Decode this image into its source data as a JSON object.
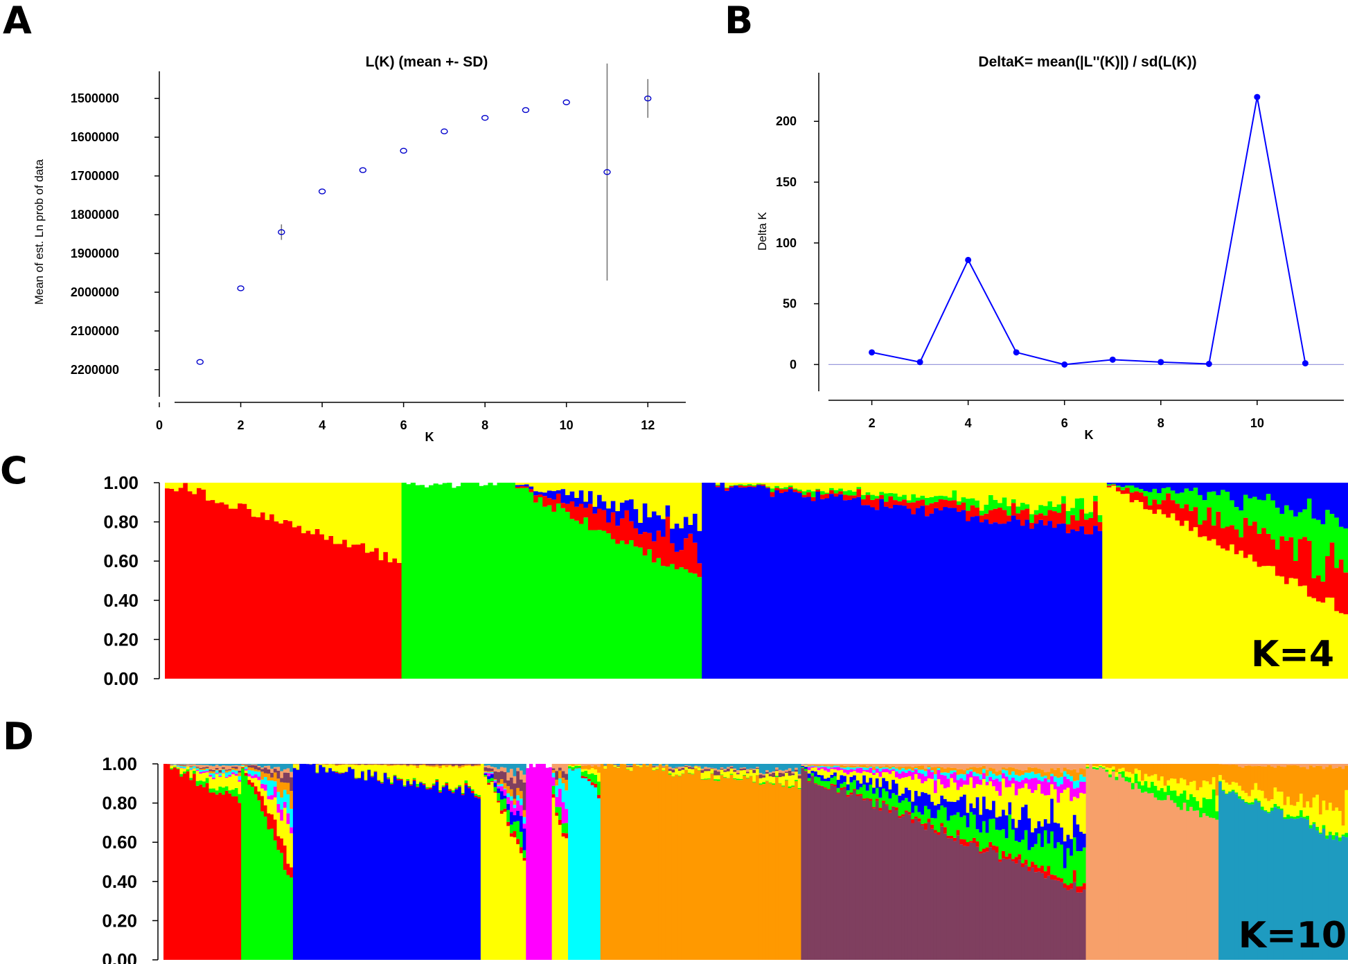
{
  "panel_labels": [
    "A",
    "B",
    "C",
    "D"
  ],
  "chart_data": [
    {
      "panel": "A",
      "type": "scatter",
      "title": "L(K) (mean +- SD)",
      "xlabel": "K",
      "ylabel": "Mean of est. Ln prob of data",
      "xlim": [
        0,
        13
      ],
      "ylim": [
        1430000,
        2270000
      ],
      "y_reversed": true,
      "x_ticks": [
        0,
        2,
        4,
        6,
        8,
        10,
        12
      ],
      "y_ticks": [
        1500000,
        1600000,
        1700000,
        1800000,
        1900000,
        2000000,
        2100000,
        2200000
      ],
      "x": [
        1,
        2,
        3,
        4,
        5,
        6,
        7,
        8,
        9,
        10,
        11,
        12
      ],
      "y": [
        2180000,
        1990000,
        1845000,
        1740000,
        1685000,
        1635000,
        1585000,
        1550000,
        1530000,
        1510000,
        1690000,
        1500000
      ],
      "sd": [
        0,
        0,
        20000,
        0,
        0,
        0,
        0,
        0,
        0,
        0,
        280000,
        50000
      ],
      "marker": "open-circle",
      "color": "#0000cc",
      "errorbar_color": "#777777"
    },
    {
      "panel": "B",
      "type": "line",
      "title": "DeltaK= mean(|L''(K)|) / sd(L(K))",
      "xlabel": "K",
      "ylabel": "Delta K",
      "xlim": [
        1.1,
        11.8
      ],
      "ylim": [
        -22,
        240
      ],
      "x_ticks": [
        2,
        4,
        6,
        8,
        10
      ],
      "y_ticks": [
        0,
        50,
        100,
        150,
        200
      ],
      "x": [
        2,
        3,
        4,
        5,
        6,
        7,
        8,
        9,
        10,
        11
      ],
      "y": [
        10,
        2,
        86,
        10,
        0,
        4,
        2,
        0.5,
        220,
        1
      ],
      "baseline": 0,
      "color": "#0000ff",
      "baseline_color": "#9999dd"
    },
    {
      "panel": "C",
      "type": "area",
      "subtype": "stacked-bar-structure",
      "label": "K=4",
      "ylim": [
        0,
        1
      ],
      "y_ticks": [
        "0.00",
        "0.20",
        "0.40",
        "0.60",
        "0.80",
        "1.00"
      ],
      "cluster_colors": [
        "#ff0000",
        "#00ff00",
        "#0000ff",
        "#ffff00"
      ],
      "n_individuals": 260,
      "groups": [
        {
          "n": 52,
          "major": 0,
          "major_from": 1.0,
          "major_to": 0.6,
          "background": [
            0,
            0,
            0,
            1
          ]
        },
        {
          "n": 23,
          "major": 1,
          "major_from": 1.0,
          "major_to": 1.0,
          "background": [
            0,
            0,
            0,
            0
          ]
        },
        {
          "n": 43,
          "major": 1,
          "major_from": 1.0,
          "major_to": 0.5,
          "background": [
            0.35,
            0,
            0.25,
            0.4
          ]
        },
        {
          "n": 88,
          "major": 2,
          "major_from": 1.0,
          "major_to": 0.75,
          "background": [
            0.3,
            0.2,
            0,
            0.5
          ]
        },
        {
          "n": 54,
          "major": 3,
          "major_from": 1.0,
          "major_to": 0.35,
          "background": [
            0.4,
            0.35,
            0.25,
            0
          ]
        }
      ]
    },
    {
      "panel": "D",
      "type": "area",
      "subtype": "stacked-bar-structure",
      "label": "K=10",
      "ylim": [
        0,
        1
      ],
      "y_ticks": [
        "0.00",
        "0.20",
        "0.40",
        "0.60",
        "0.80",
        "1.00"
      ],
      "cluster_colors": [
        "#ff0000",
        "#00ff00",
        "#0000ff",
        "#ffff00",
        "#ff00ff",
        "#00ffff",
        "#ff9900",
        "#7f3f5f",
        "#f7a06a",
        "#1e9bc0"
      ],
      "n_individuals": 340,
      "groups": [
        {
          "n": 24,
          "major": 0,
          "major_from": 1.0,
          "major_to": 0.8,
          "background": [
            0,
            0.2,
            0,
            0.4,
            0.05,
            0.1,
            0.05,
            0.05,
            0.1,
            0.05
          ]
        },
        {
          "n": 16,
          "major": 1,
          "major_from": 1.0,
          "major_to": 0.4,
          "background": [
            0.2,
            0,
            0,
            0.25,
            0.1,
            0.15,
            0.1,
            0.1,
            0.05,
            0.05
          ]
        },
        {
          "n": 58,
          "major": 2,
          "major_from": 1.0,
          "major_to": 0.85,
          "background": [
            0.05,
            0.05,
            0,
            0.8,
            0,
            0,
            0.05,
            0.05,
            0,
            0
          ]
        },
        {
          "n": 14,
          "major": 3,
          "major_from": 1.0,
          "major_to": 0.5,
          "background": [
            0.05,
            0.15,
            0.15,
            0,
            0.1,
            0.05,
            0.1,
            0.2,
            0.1,
            0.1
          ]
        },
        {
          "n": 8,
          "major": 4,
          "major_from": 1.0,
          "major_to": 1.0,
          "background": [
            0,
            0,
            0,
            0,
            0,
            0,
            0,
            0,
            0,
            0
          ]
        },
        {
          "n": 5,
          "major": 3,
          "major_from": 0.8,
          "major_to": 0.6,
          "background": [
            0.1,
            0.2,
            0,
            0,
            0.2,
            0.2,
            0.1,
            0.1,
            0.1,
            0
          ]
        },
        {
          "n": 10,
          "major": 5,
          "major_from": 1.0,
          "major_to": 0.85,
          "background": [
            0.1,
            0.4,
            0,
            0.2,
            0,
            0,
            0.2,
            0,
            0.1,
            0
          ]
        },
        {
          "n": 62,
          "major": 6,
          "major_from": 1.0,
          "major_to": 0.9,
          "background": [
            0,
            0.05,
            0,
            0.4,
            0,
            0,
            0,
            0.15,
            0.1,
            0.3
          ]
        },
        {
          "n": 88,
          "major": 7,
          "major_from": 0.95,
          "major_to": 0.35,
          "background": [
            0.05,
            0.25,
            0.2,
            0.25,
            0.1,
            0.05,
            0.05,
            0,
            0.05,
            0
          ]
        },
        {
          "n": 41,
          "major": 8,
          "major_from": 1.0,
          "major_to": 0.7,
          "background": [
            0,
            0.3,
            0,
            0.3,
            0,
            0,
            0.4,
            0,
            0,
            0
          ]
        },
        {
          "n": 40,
          "major": 9,
          "major_from": 0.88,
          "major_to": 0.6,
          "background": [
            0,
            0.05,
            0,
            0.3,
            0,
            0,
            0.6,
            0,
            0.05,
            0
          ]
        }
      ]
    }
  ]
}
